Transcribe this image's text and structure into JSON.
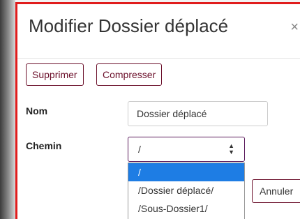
{
  "dialog": {
    "title": "Modifier Dossier déplacé",
    "close_glyph": "×"
  },
  "buttons": {
    "delete_label": "Supprimer",
    "compress_label": "Compresser",
    "cancel_label": "Annuler"
  },
  "form": {
    "name_label": "Nom",
    "name_value": "Dossier déplacé",
    "path_label": "Chemin",
    "path_value": "/",
    "path_options": [
      "/",
      "/Dossier déplacé/",
      "/Sous-Dossier1/"
    ],
    "selected_option": "/"
  },
  "colors": {
    "accent": "#6b0f2a",
    "highlight": "#1e7de4",
    "frame_border": "#e01c1c"
  }
}
